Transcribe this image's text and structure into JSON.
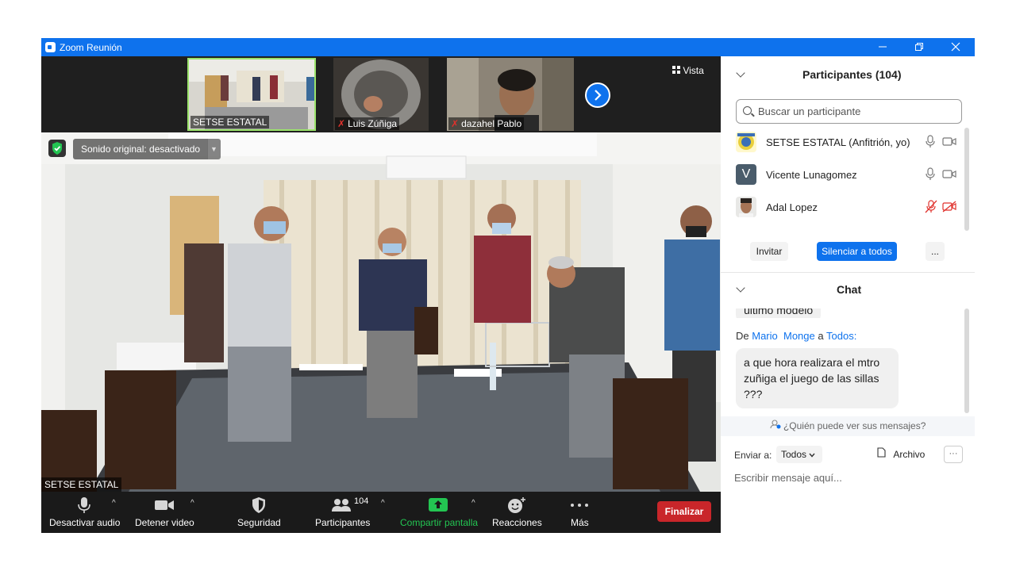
{
  "window": {
    "title": "Zoom Reunión"
  },
  "strip": {
    "thumbnails": [
      {
        "name": "SETSE ESTATAL",
        "muted": false
      },
      {
        "name": "Luis Zúñiga",
        "muted": true
      },
      {
        "name": "dazahel Pablo",
        "muted": true
      }
    ],
    "view_label": "Vista"
  },
  "main_video": {
    "audio_status": "Sonido original: desactivado",
    "speaker_name": "SETSE ESTATAL"
  },
  "toolbar": {
    "mute": "Desactivar audio",
    "video": "Detener video",
    "security": "Seguridad",
    "participants": "Participantes",
    "participants_count": "104",
    "share": "Compartir pantalla",
    "reactions": "Reacciones",
    "more": "Más",
    "end": "Finalizar"
  },
  "participants_panel": {
    "title": "Participantes (104)",
    "search_placeholder": "Buscar un participante",
    "items": [
      {
        "name": "SETSE ESTATAL (Anfitrión, yo)",
        "mic_muted": false,
        "video_off": false
      },
      {
        "name": "Vicente Lunagomez",
        "initial": "V",
        "mic_muted": false,
        "video_off": false
      },
      {
        "name": "Adal Lopez",
        "mic_muted": true,
        "video_off": true
      }
    ],
    "invite": "Invitar",
    "mute_all": "Silenciar a todos",
    "more": "..."
  },
  "chat_panel": {
    "title": "Chat",
    "prev_message_tail": "último modelo",
    "sender_prefix": "De",
    "sender_first": "Mario",
    "sender_last": "Monge",
    "to_word": "a",
    "recipient": "Todos:",
    "message": "a que hora realizara el mtro zuñiga el juego de las sillas ???",
    "who_can_see": "¿Quién puede ver sus mensajes?",
    "send_to_label": "Enviar a:",
    "send_to_value": "Todos",
    "file_label": "Archivo",
    "more_label": "···",
    "input_placeholder": "Escribir mensaje aquí..."
  },
  "colors": {
    "accent": "#0e72ed",
    "toolbar_bg": "#1a1a1a",
    "end_button": "#c9262a",
    "share_green": "#23c552",
    "muted_red": "#e0312c"
  }
}
